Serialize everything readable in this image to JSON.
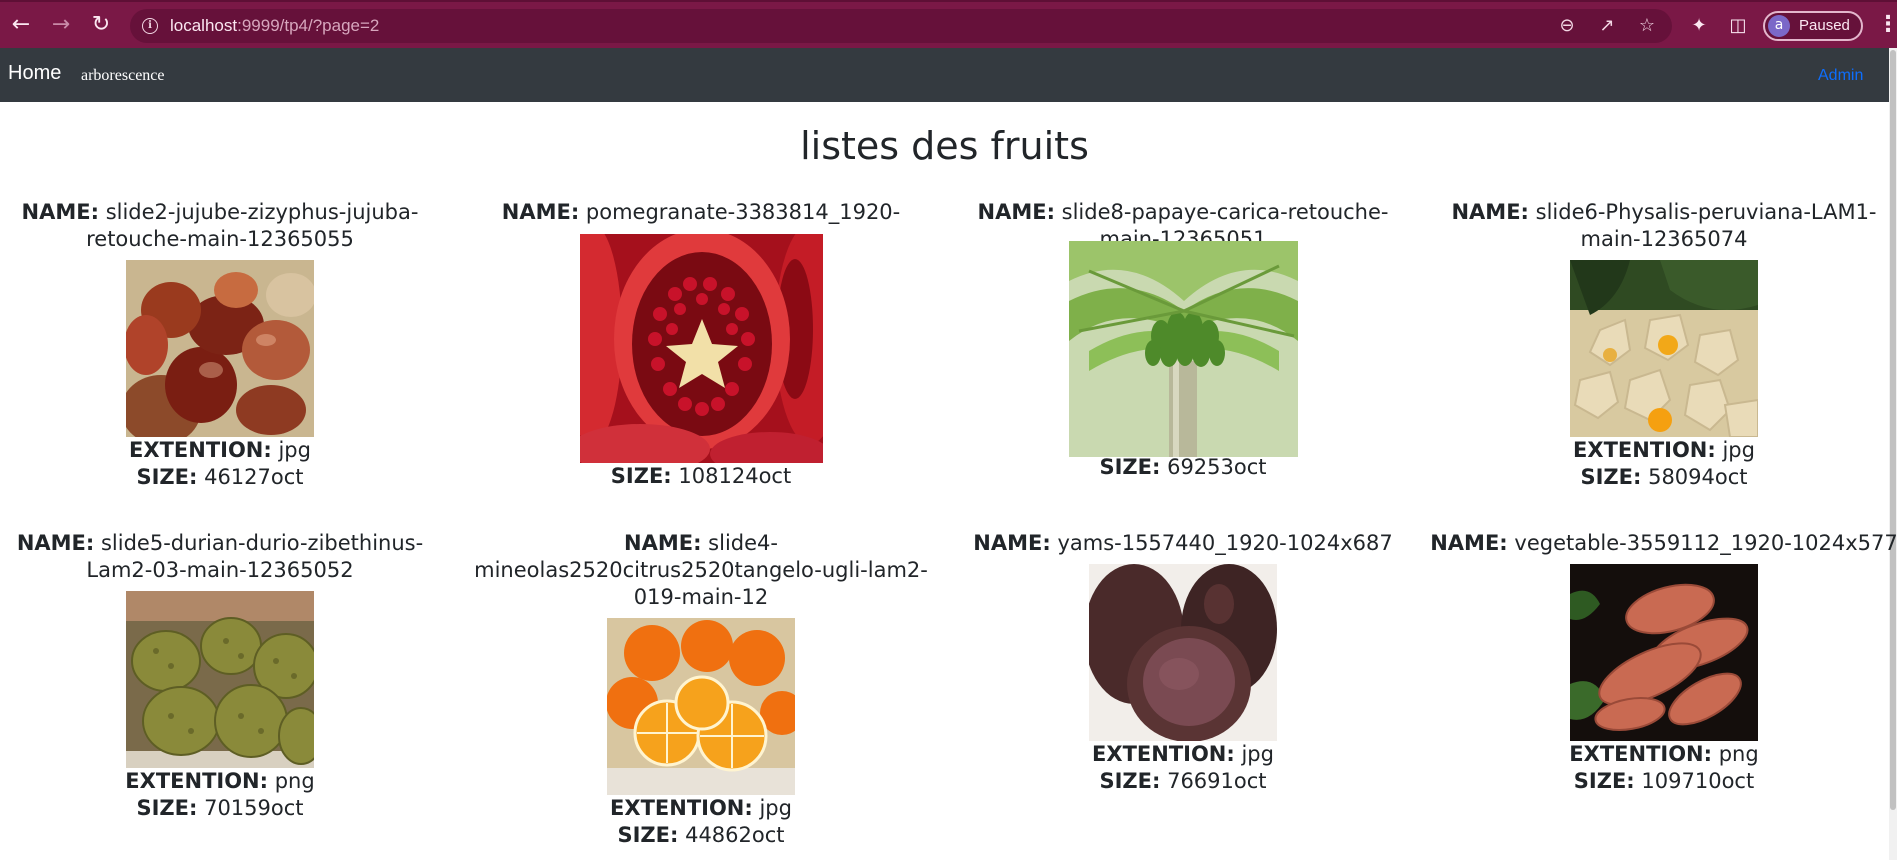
{
  "browser": {
    "url_host": "localhost",
    "url_rest": ":9999/tp4/?page=2",
    "profile_initial": "a",
    "profile_label": "Paused"
  },
  "navbar": {
    "brand": "Home",
    "link": "arborescence",
    "admin": "Admin"
  },
  "page": {
    "title": "listes des fruits",
    "name_label": "NAME:",
    "ext_label": "EXTENTION:",
    "size_label": "SIZE:"
  },
  "fruits": [
    {
      "name": "slide2-jujube-zizyphus-jujuba-retouche-main-12365055",
      "ext": "jpg",
      "size": "46127oct",
      "image": "jujube-photo"
    },
    {
      "name": "pomegranate-3383814_1920-1024x683",
      "ext": "jpg",
      "size": "108124oct",
      "image": "pomegranate-photo"
    },
    {
      "name": "slide8-papaye-carica-retouche-main-12365051",
      "ext": "jpg",
      "size": "69253oct",
      "image": "papaya-tree-photo"
    },
    {
      "name": "slide6-Physalis-peruviana-LAM1-main-12365074",
      "ext": "jpg",
      "size": "58094oct",
      "image": "physalis-photo"
    },
    {
      "name": "slide5-durian-durio-zibethinus-Lam2-03-main-12365052",
      "ext": "png",
      "size": "70159oct",
      "image": "durian-photo"
    },
    {
      "name": "slide4-mineolas2520citrus2520tangelo-ugli-lam2-019-main-12",
      "ext": "jpg",
      "size": "44862oct",
      "image": "oranges-photo"
    },
    {
      "name": "yams-1557440_1920-1024x687",
      "ext": "jpg",
      "size": "76691oct",
      "image": "yams-photo"
    },
    {
      "name": "vegetable-3559112_1920-1024x577",
      "ext": "png",
      "size": "109710oct",
      "image": "sweet-potato-photo"
    }
  ]
}
